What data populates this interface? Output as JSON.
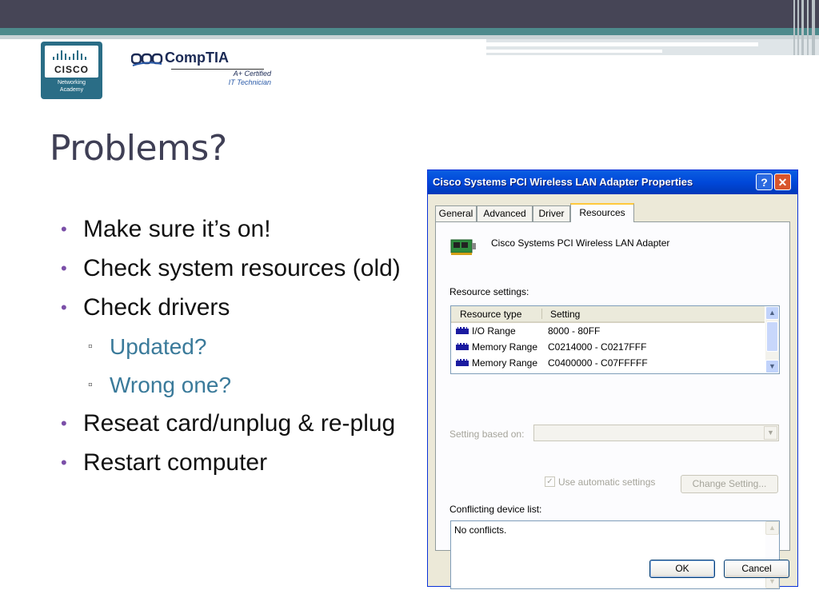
{
  "slide": {
    "title": "Problems?",
    "bullets": [
      {
        "text": "Make sure it’s on!"
      },
      {
        "text": "Check system resources (old)"
      },
      {
        "text": "Check drivers"
      },
      {
        "text": "Reseat card/unplug & re-plug"
      },
      {
        "text": "Restart computer"
      }
    ],
    "sub_bullets": [
      {
        "text": "Updated?"
      },
      {
        "text": "Wrong one?"
      }
    ]
  },
  "logos": {
    "cisco": {
      "word": "CISCO",
      "line1": "Networking",
      "line2": "Academy"
    },
    "comptia": {
      "brand": "CompTIA",
      "certified": "A+ Certified",
      "subtitle": "IT Technician"
    }
  },
  "window": {
    "title": "Cisco Systems PCI Wireless LAN Adapter Properties",
    "help_label": "?",
    "close_label": "✕",
    "tabs": [
      "General",
      "Advanced",
      "Driver",
      "Resources"
    ],
    "active_tab": "Resources",
    "device_name": "Cisco Systems PCI Wireless LAN Adapter",
    "resource_settings_label": "Resource settings:",
    "columns": [
      "Resource type",
      "Setting"
    ],
    "rows": [
      {
        "type": "I/O Range",
        "setting": "8000 - 80FF"
      },
      {
        "type": "Memory Range",
        "setting": "C0214000 - C0217FFF"
      },
      {
        "type": "Memory Range",
        "setting": "C0400000 - C07FFFFF"
      }
    ],
    "setting_based_on_label": "Setting based on:",
    "setting_based_on_value": "",
    "use_automatic_label": "Use automatic settings",
    "use_automatic_checked": true,
    "check_glyph": "✓",
    "change_setting_label": "Change Setting...",
    "conflicting_label": "Conflicting device list:",
    "conflicts_text": "No conflicts.",
    "ok_label": "OK",
    "cancel_label": "Cancel",
    "scroll_up_glyph": "▲",
    "scroll_down_glyph": "▼",
    "dropdown_glyph": "▼"
  },
  "colors": {
    "title_text": "#3f3f55",
    "bullet_marker": "#7b4fa8",
    "sub_bullet_text": "#3a7a9a",
    "titlebar_blue": "#0048d9",
    "banner_teal": "#4d8a8c"
  }
}
